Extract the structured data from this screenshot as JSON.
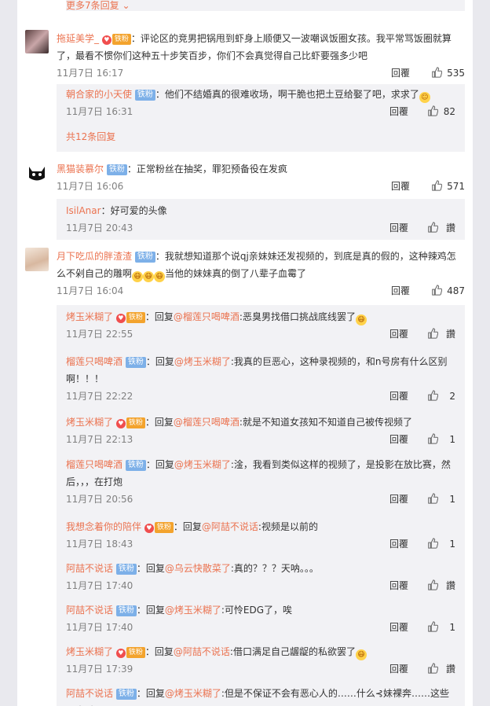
{
  "top_more": "更多7条回复",
  "comments": [
    {
      "user": "拖延美学_",
      "badge": "铁粉",
      "text": "：评论区的竞男把锅甩到虾身上顺便又一波嘲讽饭圈女孩。我平常骂饭圈就算了，最看不惯你们这种五十步笑百步，你们不会真觉得自己比虾要强多少吧",
      "time": "11月7日 16:17",
      "reply": "回覆",
      "likes": "535",
      "subreplies": [
        {
          "user": "朝合家的小天使",
          "badge": "铁粉",
          "text": "：他们不结婚真的很难收场，啊干脆也把土豆给娶了吧，求求了",
          "time": "11月7日 16:31",
          "reply": "回覆",
          "likes": "82"
        }
      ],
      "more": "共12条回复"
    },
    {
      "user": "黑猫装慕尔",
      "badge": "铁粉",
      "text": "：正常粉丝在抽奖，罪犯预备役在发疯",
      "time": "11月7日 16:06",
      "reply": "回覆",
      "likes": "571",
      "subreplies": [
        {
          "user": "IsilAnar",
          "text": "：好可爱的头像",
          "time": "11月7日 20:43",
          "reply": "回覆",
          "likes": "讚"
        }
      ]
    },
    {
      "user": "月下吃瓜的胖渣渣",
      "badge": "铁粉",
      "text": "：我就想知道那个说qj亲妹妹还发视频的，到底是真的假的，这种辣鸡怎么不剁自己的雕啊",
      "text2": "当他的妹妹真的倒了八辈子血霉了",
      "time": "11月7日 16:04",
      "reply": "回覆",
      "likes": "487",
      "subreplies": [
        {
          "user": "烤玉米糊了",
          "badge": "铁粉",
          "reply_word": "回复",
          "at": "@榴莲只喝啤酒",
          "text": ":恶臭男找借口挑战底线罢了",
          "time": "11月7日 22:55",
          "reply": "回覆",
          "likes": "讚"
        },
        {
          "user": "榴莲只喝啤酒",
          "badge": "铁粉",
          "reply_word": "回复",
          "at": "@烤玉米糊了",
          "text": ":我真的巨恶心，这种录视频的，和n号房有什么区别啊！！！",
          "time": "11月7日 22:22",
          "reply": "回覆",
          "likes": "2"
        },
        {
          "user": "烤玉米糊了",
          "badge": "铁粉",
          "reply_word": "回复",
          "at": "@榴莲只喝啤酒",
          "text": ":就是不知道女孩知不知道自己被传视频了",
          "time": "11月7日 22:13",
          "reply": "回覆",
          "likes": "1"
        },
        {
          "user": "榴莲只喝啤酒",
          "badge": "铁粉",
          "reply_word": "回复",
          "at": "@烤玉米糊了",
          "text": ":淦，我看到类似这样的视频了，是投影在放比赛，然后，，，在打炮",
          "time": "11月7日 20:56",
          "reply": "回覆",
          "likes": "1"
        },
        {
          "user": "我想念着你的陪伴",
          "badge": "铁粉",
          "reply_word": "回复",
          "at": "@阿喆不说话",
          "text": ":视频是以前的",
          "time": "11月7日 18:43",
          "reply": "回覆",
          "likes": "1"
        },
        {
          "user": "阿喆不说话",
          "badge": "铁粉",
          "reply_word": "回复",
          "at": "@乌云快散菜了",
          "text": ":真的？？？天呐。。。",
          "time": "11月7日 17:40",
          "reply": "回覆",
          "likes": "讚"
        },
        {
          "user": "阿喆不说话",
          "badge": "铁粉",
          "reply_word": "回复",
          "at": "@烤玉米糊了",
          "text": ":可怜EDG了，唉",
          "time": "11月7日 17:40",
          "reply": "回覆",
          "likes": "1"
        },
        {
          "user": "烤玉米糊了",
          "badge": "铁粉",
          "reply_word": "回复",
          "at": "@阿喆不说话",
          "text": ":借口满足自己龌龊的私欲罢了",
          "time": "11月7日 17:39",
          "reply": "回覆",
          "likes": "讚"
        },
        {
          "user": "阿喆不说话",
          "badge": "铁粉",
          "reply_word": "回复",
          "at": "@烤玉米糊了",
          "text": ":但是不保证不会有恶心人的……什么⊰妹裸奔……这些人太过分了"
        }
      ]
    }
  ]
}
